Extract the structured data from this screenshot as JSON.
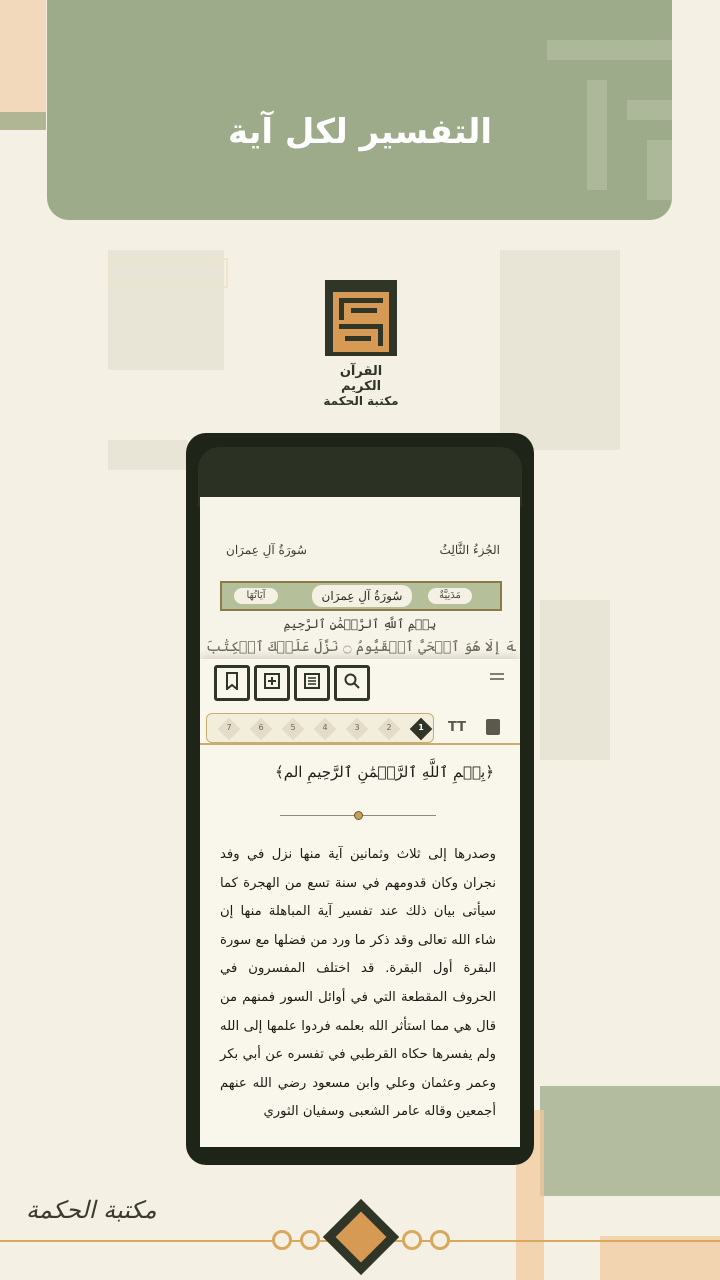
{
  "banner": {
    "title": "التفسير لكل آية"
  },
  "app_logo": {
    "line1": "القرآن الكريم",
    "line2": "مكتبة الحكمة"
  },
  "mushaf": {
    "juz_label": "الجُزءُ الثَّالِثُ",
    "surah_label": "سُورَةُ آلِ عِمرَان",
    "surah_title": "سُورَةُ آلِ عِمرَان",
    "revelation_type": "مَدَنِيَّةٌ",
    "ayah_count_label": "آيَاتُهَا",
    "basmala": "بِسۡمِ ٱللَّهِ ٱلرَّحۡمَٰنِ ٱلرَّحِيمِ",
    "first_ayah": "الٓمٓ ۝ ٱللَّهُ لَآ إِلَٰهَ إِلَّا هُوَ ٱلۡحَيُّ ٱلۡقَيُّومُ ۝ نَزَّلَ عَلَيۡكَ ٱلۡكِتَٰبَ"
  },
  "toolbar": {
    "buttons": [
      {
        "icon": "bookmark-icon",
        "glyph": "🔖"
      },
      {
        "icon": "add-note-icon",
        "glyph": "⊞"
      },
      {
        "icon": "tafsir-list-icon",
        "glyph": "☰"
      },
      {
        "icon": "search-icon",
        "glyph": "⌕"
      }
    ]
  },
  "tafsir_tabs": [
    "1",
    "2",
    "3",
    "4",
    "5",
    "6",
    "7"
  ],
  "tafsir_tabs_active": "1",
  "tafsir": {
    "basmala": "﴿بِسۡمِ ٱللَّهِ ٱلرَّحۡمَٰنِ ٱلرَّحِيمِ الم﴾",
    "body": "وصدرها إلى ثلاث وثمانين آية منها نزل في وفد نجران وكان قدومهم في سنة تسع من الهجرة كما سيأتى بيان ذلك عند تفسير آية المباهلة منها إن شاء الله تعالى وقد ذكر ما ورد من فضلها مع سورة البقرة أول البقرة. قد اختلف المفسرون في الحروف المقطعة التي في أوائل السور فمنهم من قال هي مما استأثر الله بعلمه فردوا علمها إلى الله ولم يفسرها حكاه القرطبي في تفسره عن أبي بكر وعمر وعثمان وعلي وابن مسعود رضي الله عنهم أجمعين وقاله عامر الشعبى وسفيان الثوري"
  },
  "footer": {
    "signature": "مكتبة الحكمة"
  },
  "colors": {
    "sage": "#9eab8b",
    "dark": "#2f3527",
    "gold": "#d69a55",
    "cream": "#f4f0e4"
  }
}
